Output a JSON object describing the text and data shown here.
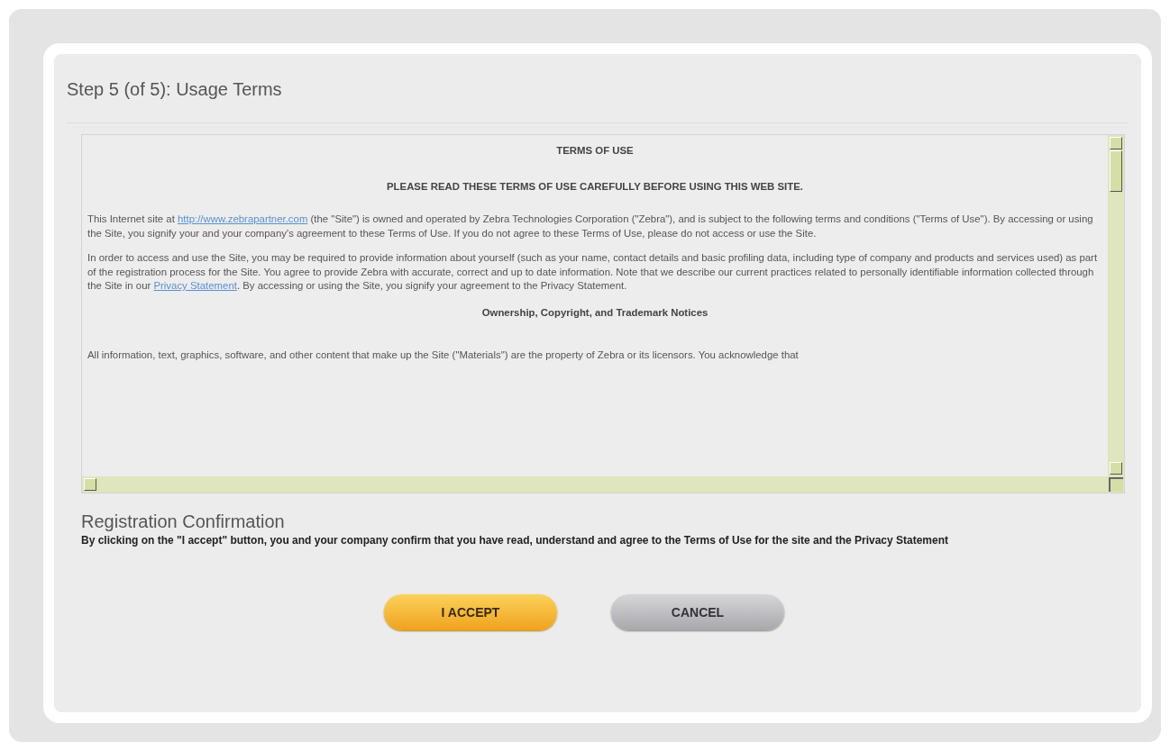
{
  "title": "Step 5 (of 5): Usage Terms",
  "terms": [
    {
      "kind": "heading",
      "text": "TERMS OF USE"
    },
    {
      "kind": "heading",
      "text": "PLEASE READ THESE TERMS OF USE CAREFULLY BEFORE USING THIS WEB SITE."
    },
    {
      "kind": "para",
      "parts": [
        {
          "kind": "text",
          "text": "This Internet site at "
        },
        {
          "kind": "link",
          "text": "http://www.zebrapartner.com"
        },
        {
          "kind": "text",
          "text": " (the \"Site\") is owned and operated by Zebra Technologies Corporation (\"Zebra\"), and is subject to the following terms and conditions (\"Terms of Use\"). By accessing or using the Site, you signify your and your company's agreement to these Terms of Use. If you do not agree to these Terms of Use, please do not access or use the Site."
        }
      ]
    },
    {
      "kind": "para",
      "parts": [
        {
          "kind": "text",
          "text": "In order to access and use the Site, you may be required to provide information about yourself (such as your name, contact details and basic profiling data, including type of company and products and services used) as part of the registration process for the Site. You agree to provide Zebra with accurate, correct and up to date information. Note that we describe our current practices related to personally identifiable information collected through the Site in our "
        },
        {
          "kind": "link",
          "text": "Privacy Statement"
        },
        {
          "kind": "text",
          "text": ". By accessing or using the Site, you signify your agreement to the Privacy Statement."
        }
      ]
    },
    {
      "kind": "subheading",
      "text": "Ownership, Copyright, and Trademark Notices"
    },
    {
      "kind": "para",
      "parts": [
        {
          "kind": "text",
          "text": "All information, text, graphics, software, and other content that make up the Site (\"Materials\") are the property of Zebra or its licensors. You acknowledge that"
        }
      ]
    }
  ],
  "confirmation": {
    "title": "Registration Confirmation",
    "text": "By clicking on the \"I accept\" button, you and your company confirm that you have read, understand and agree to the Terms of Use for the site and the Privacy Statement"
  },
  "buttons": [
    {
      "kind": "primary",
      "label": "I ACCEPT"
    },
    {
      "kind": "secondary",
      "label": "CANCEL"
    }
  ]
}
